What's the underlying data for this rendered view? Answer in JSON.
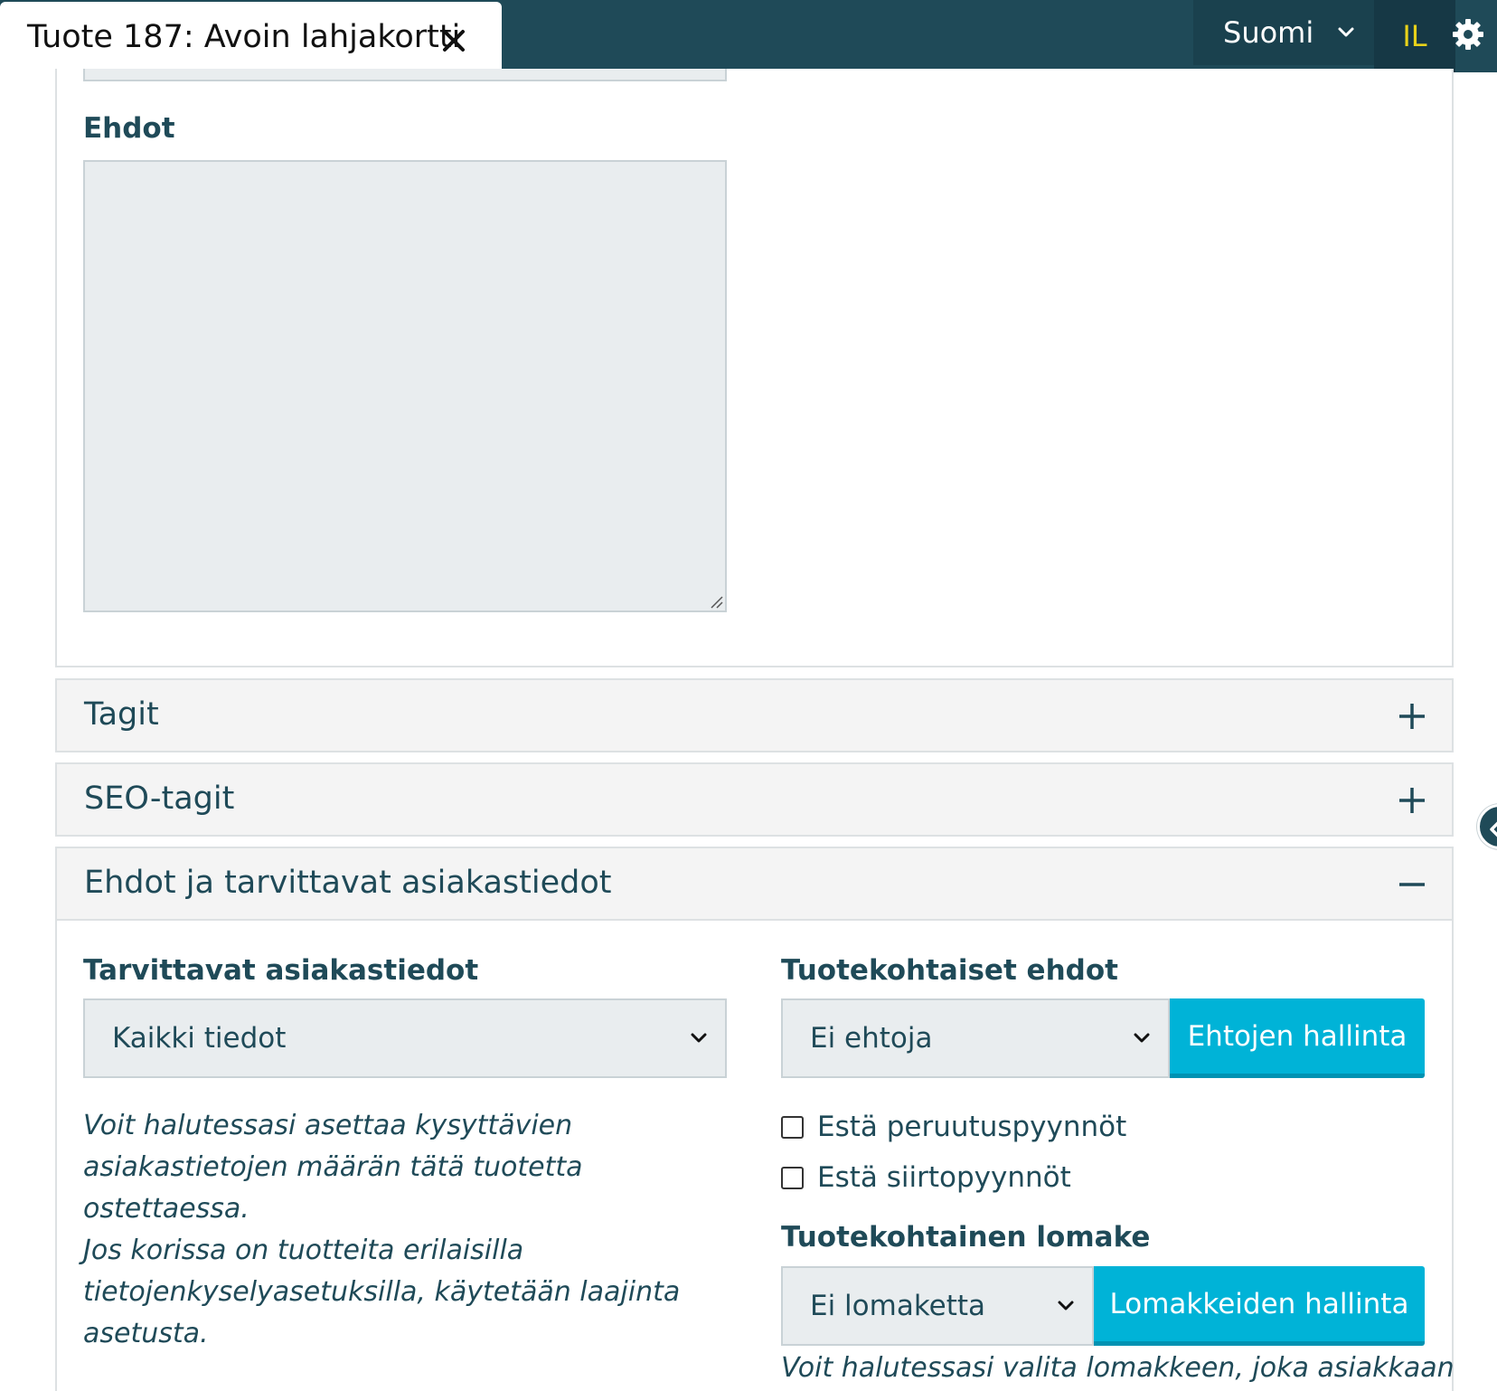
{
  "header": {
    "tab_title": "Tuote 187: Avoin lahjakortti",
    "language": "Suomi",
    "user_initials": "IL"
  },
  "conditions_field": {
    "label": "Ehdot",
    "value": ""
  },
  "accordions": {
    "tags": "Tagit",
    "seo_tags": "SEO-tagit",
    "terms_customer_info": "Ehdot ja tarvittavat asiakastiedot"
  },
  "customer_info": {
    "label": "Tarvittavat asiakastiedot",
    "selected": "Kaikki tiedot",
    "help_lines": [
      "Voit halutessasi asettaa kysyttävien",
      "asiakastietojen määrän tätä tuotetta ostettaessa.",
      "Jos korissa on tuotteita erilaisilla",
      "tietojenkyselyasetuksilla, käytetään laajinta",
      "asetusta."
    ]
  },
  "product_terms": {
    "label": "Tuotekohtaiset ehdot",
    "selected": "Ei ehtoja",
    "manage_button": "Ehtojen hallinta",
    "checkboxes": [
      {
        "label": "Estä peruutuspyynnöt",
        "checked": false
      },
      {
        "label": "Estä siirtopyynnöt",
        "checked": false
      }
    ]
  },
  "product_form": {
    "label": "Tuotekohtainen lomake",
    "selected": "Ei lomaketta",
    "manage_button": "Lomakkeiden hallinta",
    "help": "Voit halutessasi valita lomakkeen, joka asiakkaan"
  },
  "colors": {
    "header_bg": "#1f4a58",
    "accent": "#00b3d7",
    "user_initials": "#e8d21a",
    "input_bg": "#e9edef"
  }
}
